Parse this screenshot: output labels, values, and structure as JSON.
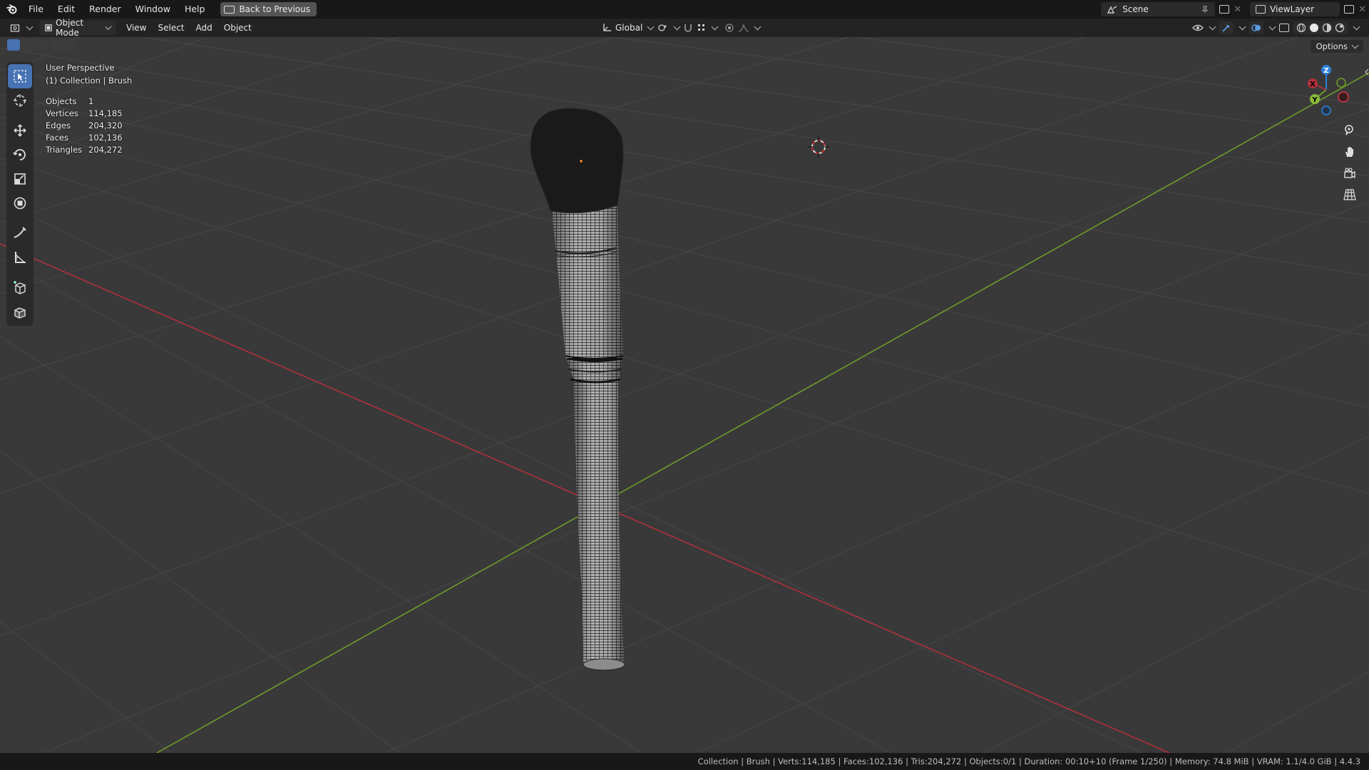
{
  "menu": {
    "items": [
      "File",
      "Edit",
      "Render",
      "Window",
      "Help"
    ],
    "back_label": "Back to Previous"
  },
  "top_right": {
    "scene": "Scene",
    "view_layer": "ViewLayer"
  },
  "header": {
    "mode": "Object Mode",
    "menus": [
      "View",
      "Select",
      "Add",
      "Object"
    ],
    "orientation": "Global",
    "options_label": "Options"
  },
  "overlay": {
    "view_name": "User Perspective",
    "collection": "(1) Collection | Brush",
    "stats": [
      {
        "label": "Objects",
        "value": "1"
      },
      {
        "label": "Vertices",
        "value": "114,185"
      },
      {
        "label": "Edges",
        "value": "204,320"
      },
      {
        "label": "Faces",
        "value": "102,136"
      },
      {
        "label": "Triangles",
        "value": "204,272"
      }
    ]
  },
  "gizmo": {
    "z": "Z",
    "y": "Y",
    "x": "X"
  },
  "status_text": "Collection | Brush | Verts:114,185 | Faces:102,136 | Tris:204,272 | Objects:0/1 | Duration: 00:10+10 (Frame 1/250) | Memory: 74.8 MiB | VRAM: 1.1/4.0 GiB | 4.4.3",
  "colors": {
    "accent": "#4772b3",
    "x_axis": "#b0303b",
    "y_axis": "#6e9a2a",
    "z_axis": "#2f7fd6",
    "viewport_bg": "#393939"
  },
  "icons": [
    "blender-logo",
    "select-box-icon",
    "cursor-icon",
    "move-icon",
    "rotate-icon",
    "scale-icon",
    "transform-icon",
    "annotate-icon",
    "measure-icon",
    "add-cube-icon",
    "extrude-icon",
    "zoom-icon",
    "hand-icon",
    "camera-icon",
    "grid-icon"
  ]
}
